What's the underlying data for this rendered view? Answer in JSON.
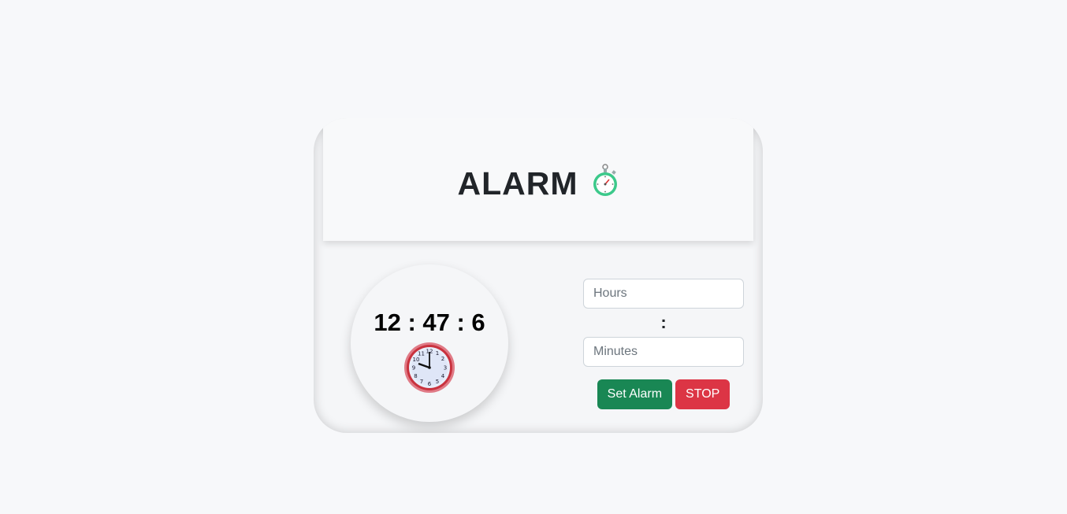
{
  "header": {
    "title": "ALARM",
    "icon": "stopwatch-icon"
  },
  "clock": {
    "time": "12 : 47 : 6",
    "icon": "wall-clock-icon"
  },
  "form": {
    "hours_placeholder": "Hours",
    "separator": ":",
    "minutes_placeholder": "Minutes",
    "set_label": "Set Alarm",
    "stop_label": "STOP"
  },
  "colors": {
    "set_button": "#198754",
    "stop_button": "#dc3545",
    "background": "#f7f8fa"
  }
}
